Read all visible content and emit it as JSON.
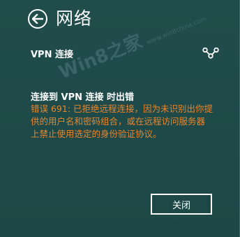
{
  "header": {
    "title": "网络"
  },
  "network": {
    "name": "VPN 连接",
    "icon": "vpn-link-icon"
  },
  "error": {
    "title": "连接到 VPN 连接 时出错",
    "message": "错误 691: 已拒绝远程连接，因为未识别出你提供的用户名和密码组合，或在远程访问服务器上禁止使用选定的身份验证协议。"
  },
  "watermark": {
    "text": "Win8之家",
    "sub": "www.win8china.com"
  },
  "actions": {
    "close_label": "关闭"
  },
  "colors": {
    "background": "#1f4a49",
    "error_text": "#e8852b",
    "foreground": "#ffffff"
  }
}
